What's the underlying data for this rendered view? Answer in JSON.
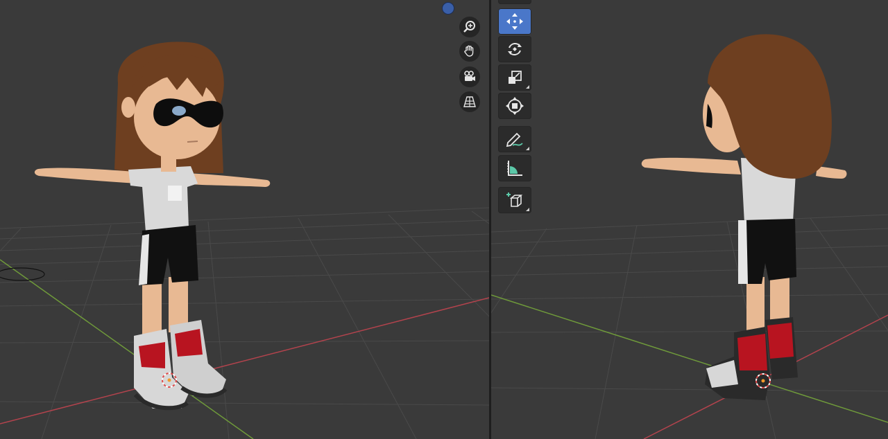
{
  "window": {
    "title": ""
  },
  "colors": {
    "viewport_bg": "#3a3a3a",
    "grid": "#4a4a4a",
    "x_axis": "#b3434d",
    "y_axis": "#6f9a3a",
    "active_tool": "#4a77c9",
    "tool_bg": "#2b2b2b",
    "skin": "#e8b993",
    "hair": "#6e3f20",
    "shirt": "#d9d9d9",
    "shorts": "#111111",
    "shoe_red": "#b81420",
    "shoe_white": "#d7d7d7",
    "mask": "#0d0d0d"
  },
  "left_viewport": {
    "navigation": [
      {
        "name": "zoom",
        "icon": "zoom-in-icon"
      },
      {
        "name": "pan",
        "icon": "hand-icon"
      },
      {
        "name": "camera",
        "icon": "camera-icon"
      },
      {
        "name": "perspective",
        "icon": "grid-perspective-icon"
      }
    ],
    "axis_ball": {
      "icon": "axis-ball-icon"
    }
  },
  "right_viewport": {
    "toolbar": [
      {
        "name": "move",
        "icon": "move-icon",
        "active": true
      },
      {
        "name": "rotate",
        "icon": "rotate-icon",
        "active": false
      },
      {
        "name": "scale",
        "icon": "scale-icon",
        "active": false
      },
      {
        "name": "transform",
        "icon": "transform-icon",
        "active": false
      },
      {
        "name": "annotate",
        "icon": "pencil-icon",
        "active": false
      },
      {
        "name": "measure",
        "icon": "measure-icon",
        "active": false
      },
      {
        "name": "add-cube",
        "icon": "add-cube-icon",
        "active": false
      }
    ]
  }
}
